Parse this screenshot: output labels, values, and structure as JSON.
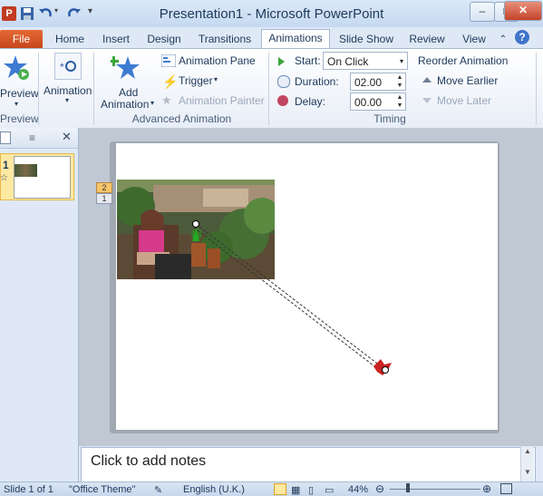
{
  "window": {
    "title": "Presentation1  -  Microsoft PowerPoint",
    "min_label": "–",
    "max_label": "□",
    "close_label": "✕"
  },
  "tabs": {
    "file": "File",
    "home": "Home",
    "insert": "Insert",
    "design": "Design",
    "transitions": "Transitions",
    "animations": "Animations",
    "slideshow": "Slide Show",
    "review": "Review",
    "view": "View"
  },
  "ribbon": {
    "preview": {
      "button": "Preview",
      "group": "Preview"
    },
    "animation": {
      "button": "Animation"
    },
    "advanced": {
      "add_animation_line1": "Add",
      "add_animation_line2": "Animation",
      "animation_pane": "Animation Pane",
      "trigger": "Trigger",
      "animation_painter": "Animation Painter",
      "group": "Advanced Animation"
    },
    "timing": {
      "start_label": "Start:",
      "start_value": "On Click",
      "duration_label": "Duration:",
      "duration_value": "02.00",
      "delay_label": "Delay:",
      "delay_value": "00.00",
      "group": "Timing"
    },
    "reorder": {
      "title": "Reorder Animation",
      "move_earlier": "Move Earlier",
      "move_later": "Move Later"
    }
  },
  "slides_panel": {
    "slide_number": "1"
  },
  "slide": {
    "badge_2": "2",
    "badge_1": "1"
  },
  "notes": {
    "placeholder": "Click to add notes"
  },
  "status": {
    "slide_info": "Slide 1 of 1",
    "theme": "\"Office Theme\"",
    "language": "English (U.K.)",
    "zoom": "44%"
  },
  "colors": {
    "file_tab": "#d55a2b",
    "accent": "#1e395b",
    "motion_start": "#22aa22",
    "motion_end": "#cc2222"
  }
}
